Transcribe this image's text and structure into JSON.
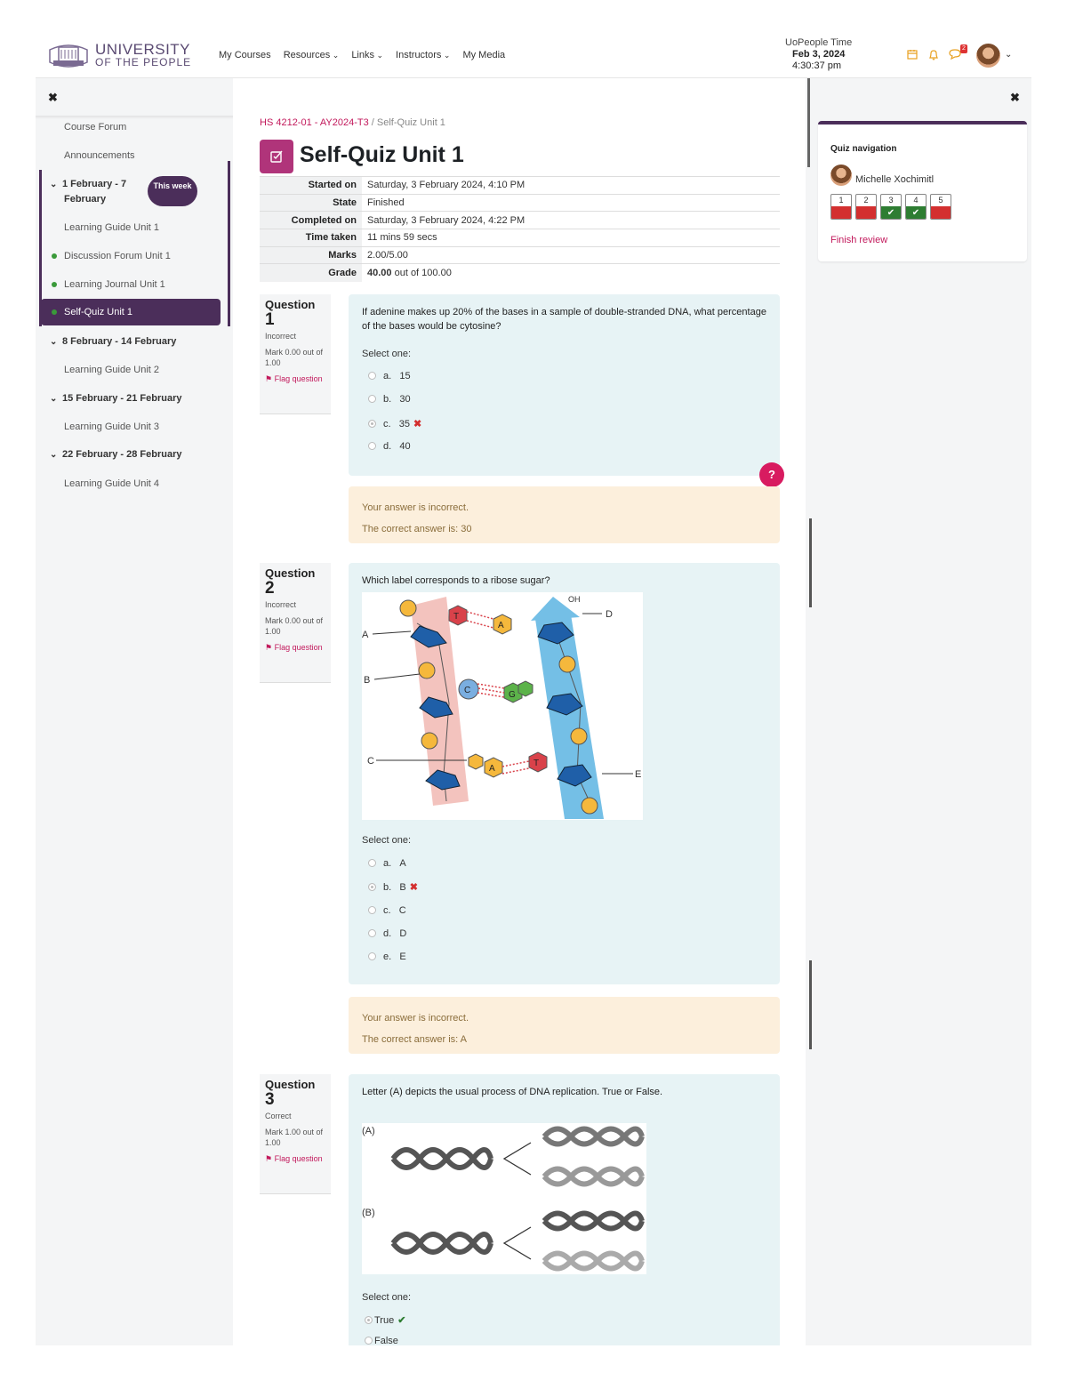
{
  "header": {
    "logo_line1": "UNIVERSITY",
    "logo_line2": "OF THE PEOPLE",
    "nav": [
      "My Courses",
      "Resources",
      "Links",
      "Instructors",
      "My Media"
    ],
    "clock_label": "UoPeople Time",
    "clock_date": "Feb 3, 2024",
    "clock_time": "4:30:37 pm",
    "message_badge": "2"
  },
  "drawer": {
    "items": {
      "course_forum": "Course Forum",
      "announcements": "Announcements",
      "week1": "1 February - 7",
      "week1_b": "February",
      "this_week": "This week",
      "lg1": "Learning Guide Unit 1",
      "df1": "Discussion Forum Unit 1",
      "lj1": "Learning Journal Unit 1",
      "sq1": "Self-Quiz Unit 1",
      "week2": "8 February - 14 February",
      "lg2": "Learning Guide Unit 2",
      "week3": "15 February - 21 February",
      "lg3": "Learning Guide Unit 3",
      "week4": "22 February - 28 February",
      "lg4": "Learning Guide Unit 4"
    }
  },
  "breadcrumb": {
    "course": "HS 4212-01 - AY2024-T3",
    "sep": "/",
    "page": "Self-Quiz Unit 1"
  },
  "title": "Self-Quiz Unit 1",
  "summary": [
    {
      "k": "Started on",
      "v": "Saturday, 3 February 2024, 4:10 PM"
    },
    {
      "k": "State",
      "v": "Finished"
    },
    {
      "k": "Completed on",
      "v": "Saturday, 3 February 2024, 4:22 PM"
    },
    {
      "k": "Time taken",
      "v": "11 mins 59 secs"
    },
    {
      "k": "Marks",
      "v": "2.00/5.00"
    },
    {
      "k": "Grade",
      "v_bold": "40.00",
      "v": "out of 100.00"
    }
  ],
  "questions": [
    {
      "label": "Question",
      "num": "1",
      "state": "Incorrect",
      "mark": "Mark 0.00 out of 1.00",
      "flag": "Flag question",
      "text": "If adenine makes up 20% of the bases in a sample of double-stranded DNA, what percentage of the bases would be cytosine?",
      "select": "Select one:",
      "options": [
        {
          "l": "a.",
          "t": "15"
        },
        {
          "l": "b.",
          "t": "30"
        },
        {
          "l": "c.",
          "t": "35"
        },
        {
          "l": "d.",
          "t": "40"
        }
      ],
      "feedback1": "Your answer is incorrect.",
      "feedback2": "The correct answer is: 30"
    },
    {
      "label": "Question",
      "num": "2",
      "state": "Incorrect",
      "mark": "Mark 0.00 out of 1.00",
      "flag": "Flag question",
      "text": "Which label corresponds to a ribose sugar?",
      "select": "Select one:",
      "options": [
        {
          "l": "a.",
          "t": "A"
        },
        {
          "l": "b.",
          "t": "B"
        },
        {
          "l": "c.",
          "t": "C"
        },
        {
          "l": "d.",
          "t": "D"
        },
        {
          "l": "e.",
          "t": "E"
        }
      ],
      "feedback1": "Your answer is incorrect.",
      "feedback2": "The correct answer is: A"
    },
    {
      "label": "Question",
      "num": "3",
      "state": "Correct",
      "mark": "Mark 1.00 out of 1.00",
      "flag": "Flag question",
      "text": "Letter (A) depicts the usual process of DNA replication.  True or False.",
      "select": "Select one:",
      "options": [
        {
          "t": "True"
        },
        {
          "t": "False"
        }
      ]
    }
  ],
  "figure_labels": {
    "a": "A",
    "b": "B",
    "c": "C",
    "d": "D",
    "e": "E",
    "oh": "OH",
    "base_t": "T",
    "base_a": "A",
    "base_c": "C",
    "base_g": "G",
    "rep_a": "(A)",
    "rep_b": "(B)"
  },
  "quiz_nav": {
    "title": "Quiz navigation",
    "user": "Michelle Xochimitl",
    "buttons": [
      {
        "n": "1",
        "s": "bad"
      },
      {
        "n": "2",
        "s": "bad"
      },
      {
        "n": "3",
        "s": "ok"
      },
      {
        "n": "4",
        "s": "ok"
      },
      {
        "n": "5",
        "s": "bad"
      }
    ],
    "finish": "Finish review"
  },
  "help": "?",
  "colors": {
    "brand": "#4b2e5a",
    "accent": "#c2185b",
    "incorrect": "#d32f2f",
    "correct": "#2e7d32"
  }
}
